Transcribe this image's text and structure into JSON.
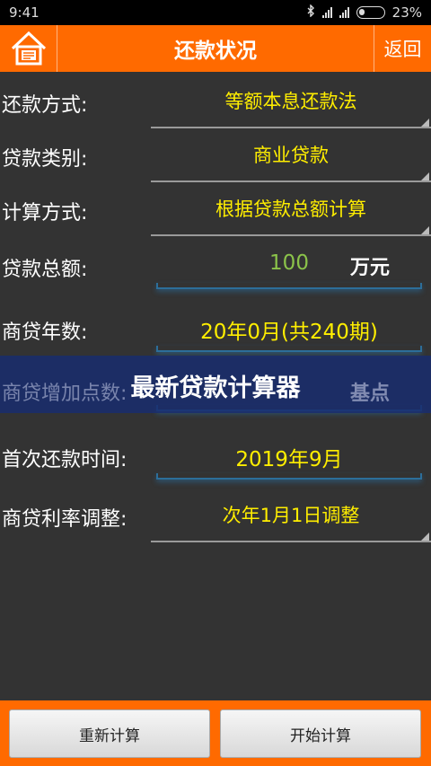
{
  "status_bar": {
    "time": "9:41",
    "battery": "23%"
  },
  "header": {
    "title": "还款状况",
    "back_label": "返回"
  },
  "form": {
    "repayment_method": {
      "label": "还款方式:",
      "value": "等额本息还款法"
    },
    "loan_type": {
      "label": "贷款类别:",
      "value": "商业贷款"
    },
    "calc_method": {
      "label": "计算方式:",
      "value": "根据贷款总额计算"
    },
    "loan_amount": {
      "label": "贷款总额:",
      "value": "100",
      "unit": "万元"
    },
    "loan_years": {
      "label": "商贷年数:",
      "value": "20年0月(共240期)"
    },
    "rate_points": {
      "label": "商贷增加点数:",
      "unit": "基点"
    },
    "first_payment": {
      "label": "首次还款时间:",
      "value": "2019年9月"
    },
    "rate_adjust": {
      "label": "商贷利率调整:",
      "value": "次年1月1日调整"
    }
  },
  "banner": {
    "text": "最新贷款计算器"
  },
  "buttons": {
    "recalc": "重新计算",
    "start": "开始计算"
  },
  "colors": {
    "accent": "#ff6a00",
    "value_text": "#ffee00",
    "input_text": "#8bc34a",
    "background": "#333333"
  }
}
